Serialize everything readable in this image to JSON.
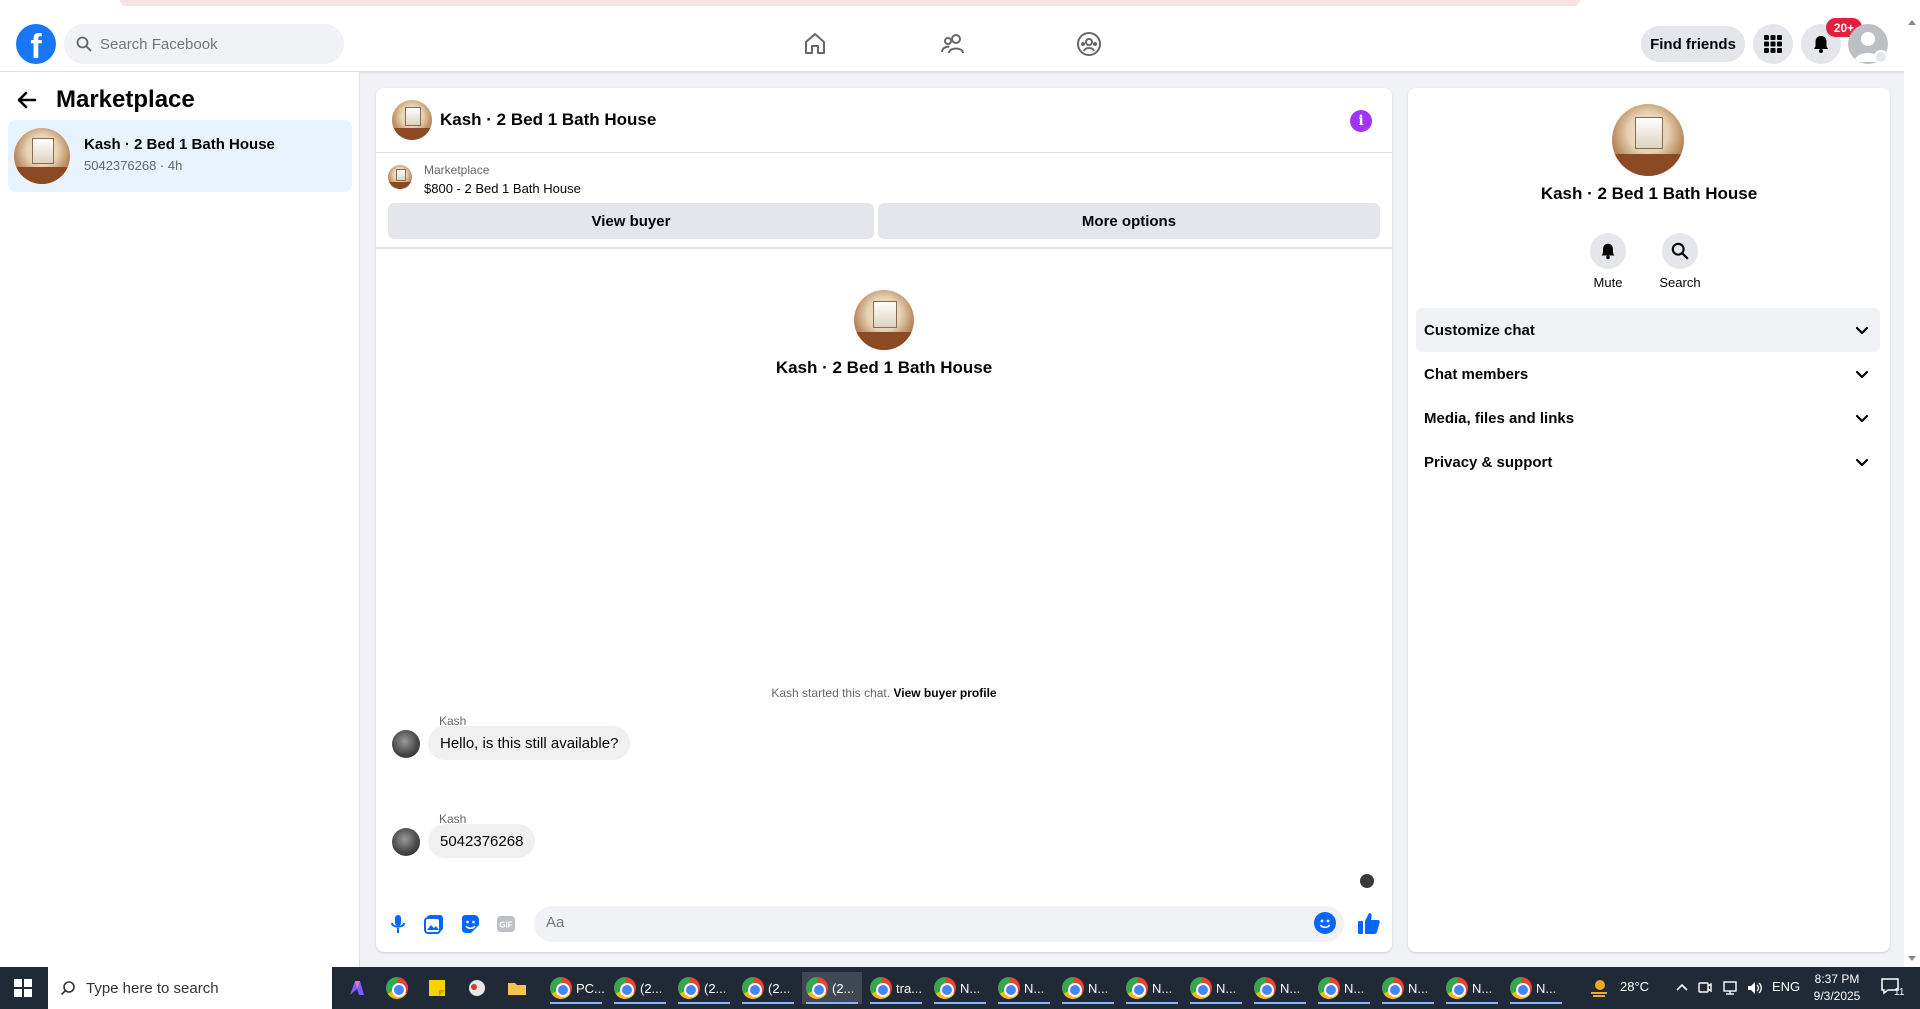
{
  "header": {
    "search_placeholder": "Search Facebook",
    "find_friends_label": "Find friends",
    "notification_count": "20+",
    "logo_letter": "f"
  },
  "sidebar": {
    "title": "Marketplace",
    "conversations": [
      {
        "title": "Kash · 2 Bed 1 Bath House",
        "subtitle": "5042376268 · 4h"
      }
    ]
  },
  "chat": {
    "title": "Kash · 2 Bed 1 Bath House",
    "listing_label": "Marketplace",
    "listing_text": "$800 - 2 Bed 1 Bath House",
    "view_buyer_label": "View buyer",
    "more_options_label": "More options",
    "intro_name": "Kash · 2 Bed 1 Bath House",
    "started_note": "Kash started this chat.",
    "started_link": "View buyer profile",
    "messages": [
      {
        "sender": "Kash",
        "text": "Hello, is this still available?"
      },
      {
        "sender": "Kash",
        "text": "5042376268"
      }
    ],
    "composer_placeholder": "Aa",
    "gif_label": "GIF"
  },
  "details_panel": {
    "title": "Kash · 2 Bed 1 Bath House",
    "actions": [
      {
        "label": "Mute",
        "icon": "bell-icon"
      },
      {
        "label": "Search",
        "icon": "search-icon"
      }
    ],
    "sections": [
      {
        "label": "Customize chat"
      },
      {
        "label": "Chat members"
      },
      {
        "label": "Media, files and links"
      },
      {
        "label": "Privacy & support"
      }
    ]
  },
  "taskbar": {
    "search_placeholder": "Type here to search",
    "apps": [
      {
        "label": "PC..."
      },
      {
        "label": "(2..."
      },
      {
        "label": "(2..."
      },
      {
        "label": "(2..."
      },
      {
        "label": "(2..."
      },
      {
        "label": "tra..."
      },
      {
        "label": "N..."
      },
      {
        "label": "N..."
      },
      {
        "label": "N..."
      },
      {
        "label": "N..."
      },
      {
        "label": "N..."
      },
      {
        "label": "N..."
      },
      {
        "label": "N..."
      },
      {
        "label": "N..."
      },
      {
        "label": "N..."
      },
      {
        "label": "N..."
      }
    ],
    "weather": "28°C",
    "language": "ENG",
    "time": "8:37 PM",
    "date": "9/3/2025",
    "notification_count": "11"
  },
  "colors": {
    "brand": "#1877f2",
    "info_purple": "#a033ff",
    "badge_red": "#e41e3f",
    "messenger_blue": "#0866ff"
  }
}
